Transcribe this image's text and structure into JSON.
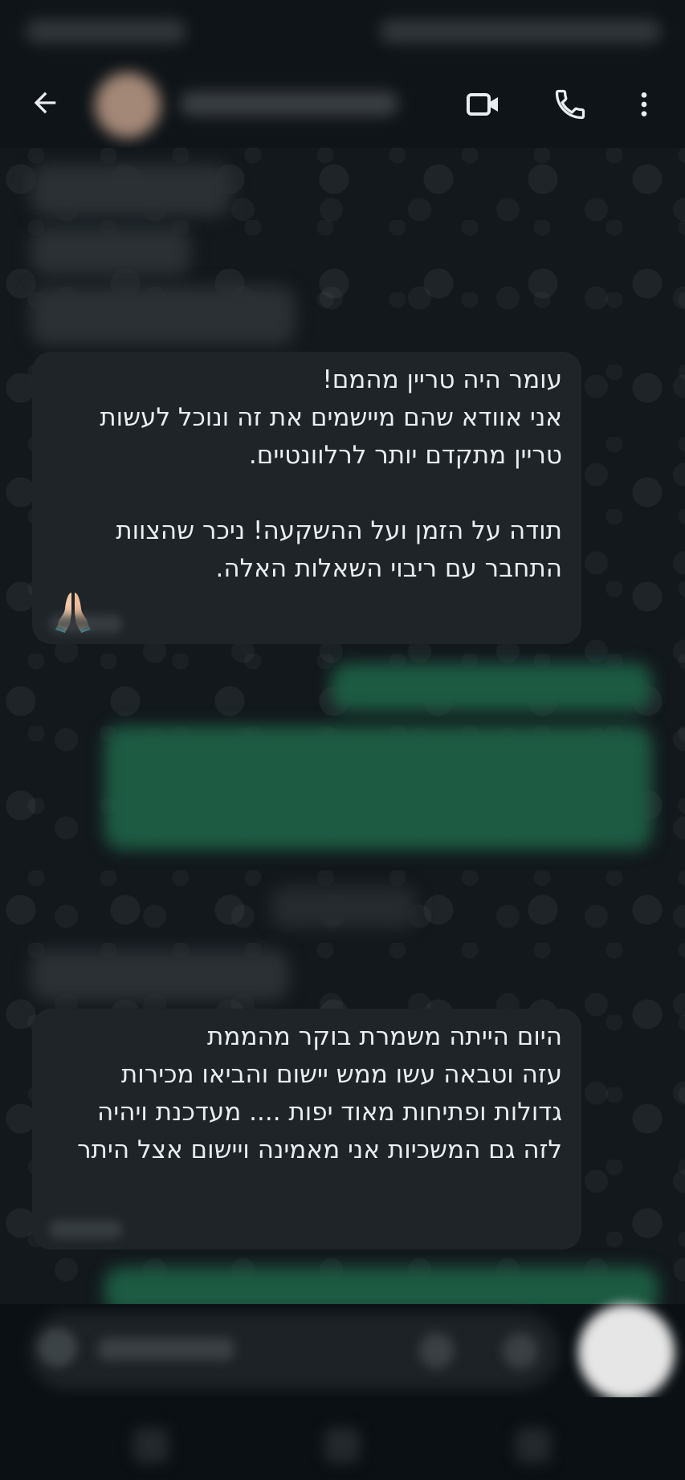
{
  "header": {
    "back_icon": "arrow-left-icon",
    "video_icon": "video-camera-icon",
    "call_icon": "phone-icon",
    "menu_icon": "more-vertical-icon"
  },
  "messages": [
    {
      "direction": "incoming",
      "text": "עומר היה טריין מהמם!\nאני אוודא שהם מיישמים את זה ונוכל לעשות טריין מתקדם יותר לרלוונטיים.\n\nתודה על הזמן ועל ההשקעה! ניכר שהצוות התחבר עם ריבוי השאלות האלה.",
      "emoji": "🙏"
    },
    {
      "direction": "incoming",
      "text": "היום הייתה משמרת בוקר מהממת\nעזה וטבאה עשו ממש יישום והביאו מכירות גדולות ופתיחות מאוד יפות .... מעדכנת ויהיה לזה גם המשכיות אני מאמינה ויישום אצל היתר"
    }
  ],
  "colors": {
    "chat_background": "#12181c",
    "incoming_bubble": "#1f2428",
    "outgoing_bubble": "#1d5b43",
    "header": "#0f1418"
  }
}
